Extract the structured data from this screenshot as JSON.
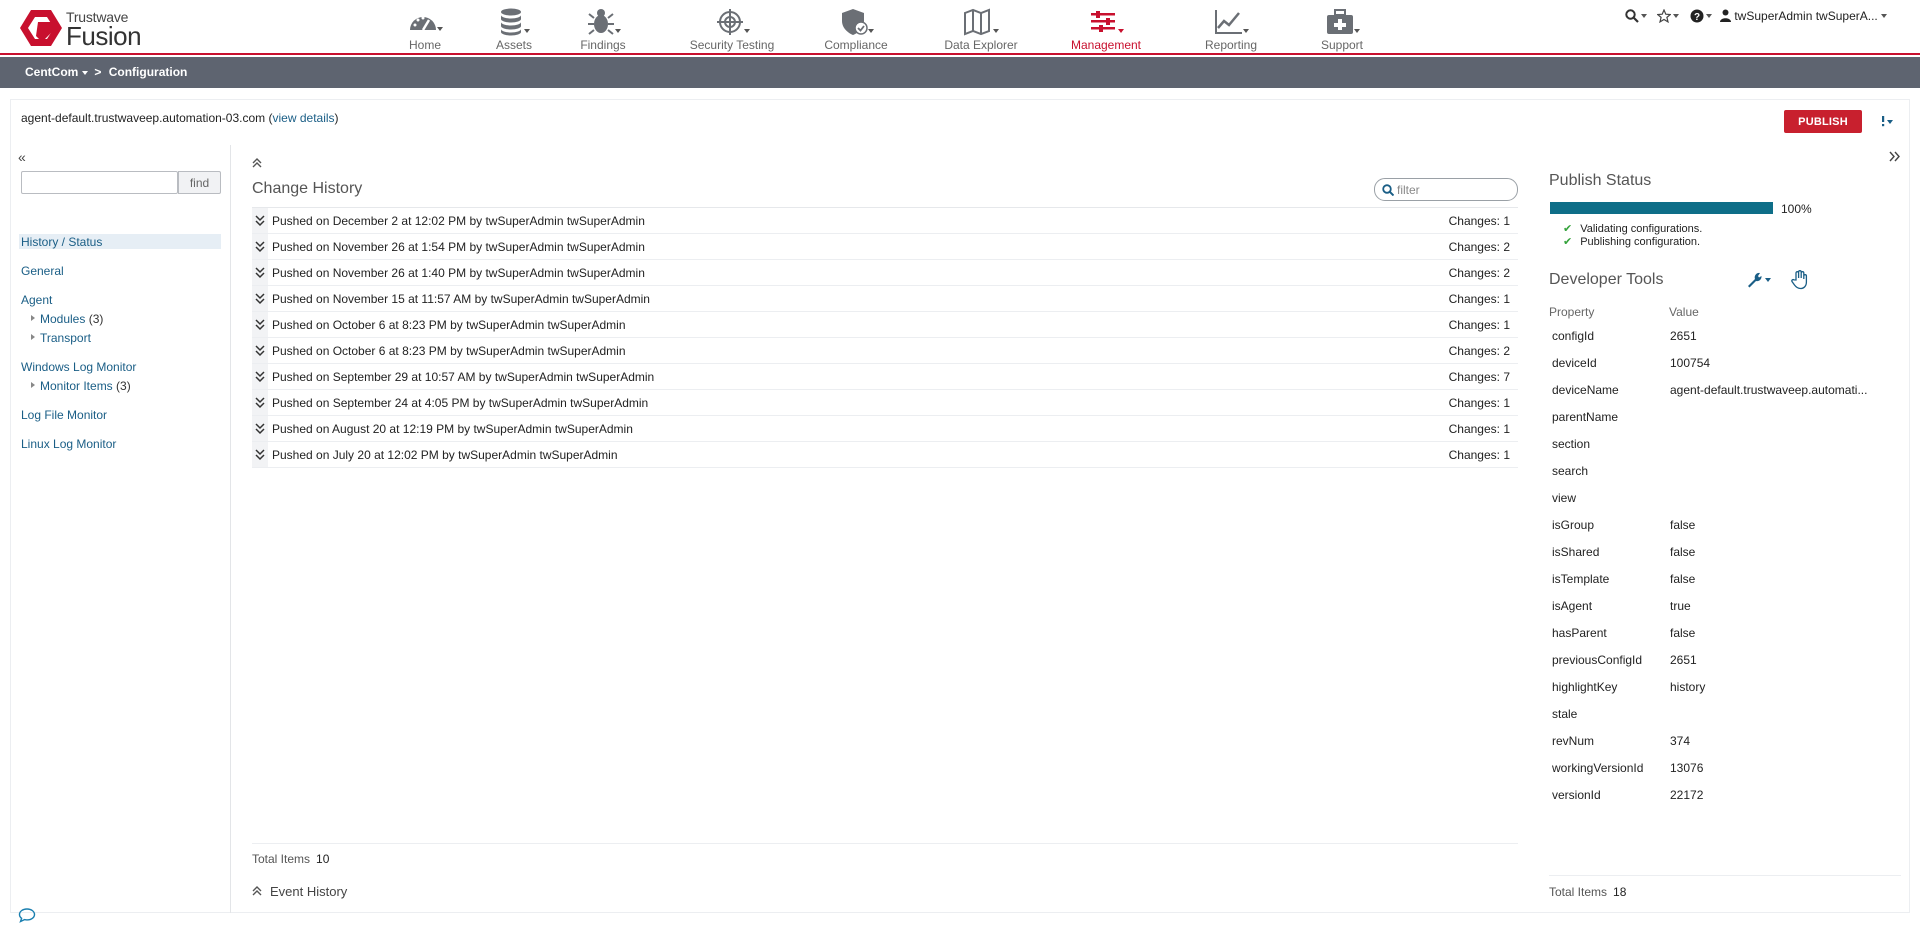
{
  "brand": {
    "top": "Trustwave",
    "name": "Fusion"
  },
  "nav": [
    {
      "label": "Home",
      "icon": "dashboard-gauge-icon"
    },
    {
      "label": "Assets",
      "icon": "database-icon"
    },
    {
      "label": "Findings",
      "icon": "bug-icon"
    },
    {
      "label": "Security Testing",
      "icon": "crosshair-target-icon"
    },
    {
      "label": "Compliance",
      "icon": "shield-check-icon"
    },
    {
      "label": "Data Explorer",
      "icon": "map-icon"
    },
    {
      "label": "Management",
      "icon": "sliders-icon",
      "active": true
    },
    {
      "label": "Reporting",
      "icon": "line-chart-icon"
    },
    {
      "label": "Support",
      "icon": "first-aid-kit-icon"
    }
  ],
  "util": {
    "user": "twSuperAdmin twSuperA..."
  },
  "breadcrumb": {
    "root": "CentCom",
    "sep": ">",
    "current": "Configuration"
  },
  "device": {
    "name": "agent-default.trustwaveep.automation-03.com",
    "details_link": "view details",
    "open": "(",
    "close": ")"
  },
  "publish": {
    "label": "PUBLISH"
  },
  "left": {
    "collapse": "«",
    "find_button": "find",
    "find_value": "",
    "items": {
      "history": "History / Status",
      "general": "General",
      "agent": "Agent",
      "modules": "Modules",
      "modules_count": "(3)",
      "transport": "Transport",
      "wlm": "Windows Log Monitor",
      "monitor_items": "Monitor Items",
      "monitor_count": "(3)",
      "lfm": "Log File Monitor",
      "llm": "Linux Log Monitor"
    }
  },
  "change_history": {
    "title": "Change History",
    "filter_placeholder": "filter",
    "rows": [
      {
        "text": "Pushed on December 2 at 12:02 PM by twSuperAdmin twSuperAdmin",
        "changes": "Changes: 1"
      },
      {
        "text": "Pushed on November 26 at 1:54 PM by twSuperAdmin twSuperAdmin",
        "changes": "Changes: 2"
      },
      {
        "text": "Pushed on November 26 at 1:40 PM by twSuperAdmin twSuperAdmin",
        "changes": "Changes: 2"
      },
      {
        "text": "Pushed on November 15 at 11:57 AM by twSuperAdmin twSuperAdmin",
        "changes": "Changes: 1"
      },
      {
        "text": "Pushed on October 6 at 8:23 PM by twSuperAdmin twSuperAdmin",
        "changes": "Changes: 1"
      },
      {
        "text": "Pushed on October 6 at 8:23 PM by twSuperAdmin twSuperAdmin",
        "changes": "Changes: 2"
      },
      {
        "text": "Pushed on September 29 at 10:57 AM by twSuperAdmin twSuperAdmin",
        "changes": "Changes: 7"
      },
      {
        "text": "Pushed on September 24 at 4:05 PM by twSuperAdmin twSuperAdmin",
        "changes": "Changes: 1"
      },
      {
        "text": "Pushed on August 20 at 12:19 PM by twSuperAdmin twSuperAdmin",
        "changes": "Changes: 1"
      },
      {
        "text": "Pushed on July 20 at 12:02 PM by twSuperAdmin twSuperAdmin",
        "changes": "Changes: 1"
      }
    ],
    "total_label": "Total Items",
    "total_value": "10",
    "event_history": "Event History"
  },
  "publish_status": {
    "title": "Publish Status",
    "progress": 100,
    "progress_label": "100%",
    "steps": [
      "Validating configurations.",
      "Publishing configuration."
    ]
  },
  "dev_tools": {
    "title": "Developer Tools",
    "col_property": "Property",
    "col_value": "Value",
    "rows": [
      {
        "k": "configId",
        "v": "2651"
      },
      {
        "k": "deviceId",
        "v": "100754"
      },
      {
        "k": "deviceName",
        "v": "agent-default.trustwaveep.automati..."
      },
      {
        "k": "parentName",
        "v": ""
      },
      {
        "k": "section",
        "v": ""
      },
      {
        "k": "search",
        "v": ""
      },
      {
        "k": "view",
        "v": ""
      },
      {
        "k": "isGroup",
        "v": "false"
      },
      {
        "k": "isShared",
        "v": "false"
      },
      {
        "k": "isTemplate",
        "v": "false"
      },
      {
        "k": "isAgent",
        "v": "true"
      },
      {
        "k": "hasParent",
        "v": "false"
      },
      {
        "k": "previousConfigId",
        "v": "2651"
      },
      {
        "k": "highlightKey",
        "v": "history"
      },
      {
        "k": "stale",
        "v": ""
      },
      {
        "k": "revNum",
        "v": "374"
      },
      {
        "k": "workingVersionId",
        "v": "13076"
      },
      {
        "k": "versionId",
        "v": "22172"
      }
    ],
    "total_label": "Total Items",
    "total_value": "18"
  },
  "colors": {
    "brand_red": "#c8102e",
    "link": "#1a5e86",
    "progress": "#0e6e88",
    "crumb_bar": "#5e6470"
  }
}
